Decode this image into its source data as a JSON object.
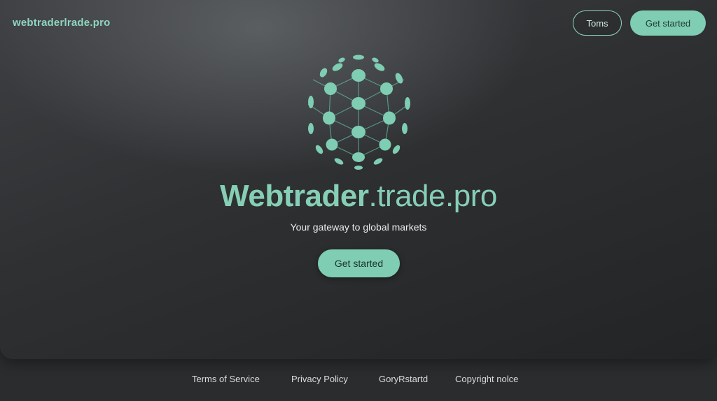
{
  "header": {
    "brand": "webtraderlrade.pro",
    "terms_button": "Toms",
    "get_started_button": "Get started"
  },
  "hero": {
    "logo_icon": "globe-network-icon",
    "title_bold": "Webtrader",
    "title_rest": ".trade.pro",
    "tagline": "Your gateway to global markets",
    "cta_label": "Get started"
  },
  "footer": {
    "links": [
      "Terms of Service",
      "Privacy Policy",
      "GoryRstartd",
      "Copyright nolce"
    ]
  },
  "colors": {
    "accent": "#7fcdb2",
    "background": "#2e3032",
    "text_light": "#e8ecec"
  }
}
